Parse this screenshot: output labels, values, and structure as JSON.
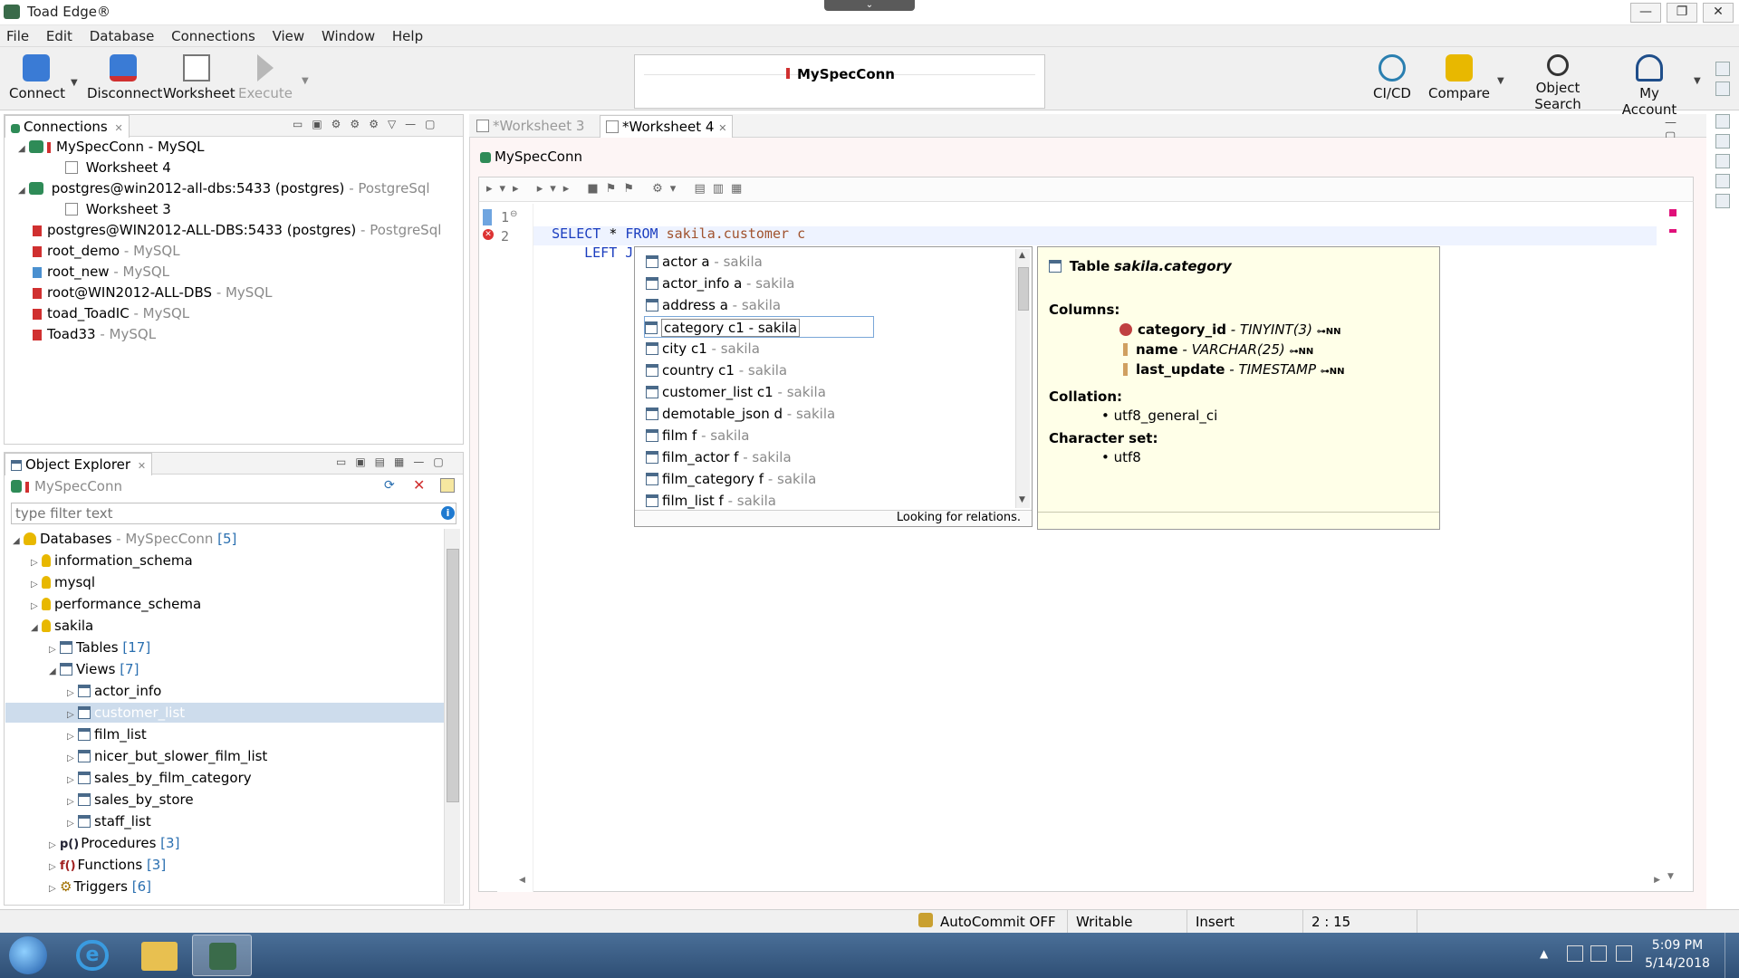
{
  "window": {
    "title": "Toad Edge®",
    "minimize": "—",
    "restore": "❐",
    "close": "✕"
  },
  "menu": [
    "File",
    "Edit",
    "Database",
    "Connections",
    "View",
    "Window",
    "Help"
  ],
  "toolbar": {
    "connect": "Connect",
    "disconnect": "Disconnect",
    "worksheet": "Worksheet",
    "execute": "Execute",
    "active_connection": "MySpecConn",
    "cicd": "CI/CD",
    "compare": "Compare",
    "object_search": "Object Search",
    "my_account": "My Account"
  },
  "connections_panel": {
    "title": "Connections",
    "items": [
      {
        "name": "MySpecConn",
        "type": "- MySQL"
      },
      {
        "name": "Worksheet 4",
        "type": ""
      },
      {
        "name": "postgres@win2012-all-dbs:5433 (postgres)",
        "type": "- PostgreSql"
      },
      {
        "name": "Worksheet 3",
        "type": ""
      },
      {
        "name": "postgres@WIN2012-ALL-DBS:5433 (postgres)",
        "type": "- PostgreSql"
      },
      {
        "name": "root_demo",
        "type": "- MySQL"
      },
      {
        "name": "root_new",
        "type": "- MySQL"
      },
      {
        "name": "root@WIN2012-ALL-DBS",
        "type": "- MySQL"
      },
      {
        "name": "toad_ToadIC",
        "type": "- MySQL"
      },
      {
        "name": "Toad33",
        "type": "- MySQL"
      }
    ]
  },
  "object_explorer": {
    "title": "Object Explorer",
    "connection": "MySpecConn",
    "filter_placeholder": "type filter text",
    "tree": {
      "databases": {
        "label": "Databases",
        "conn": "- MySpecConn",
        "count": "[5]"
      },
      "information_schema": "information_schema",
      "mysql": "mysql",
      "performance_schema": "performance_schema",
      "sakila": "sakila",
      "tables": {
        "label": "Tables",
        "count": "[17]"
      },
      "views": {
        "label": "Views",
        "count": "[7]"
      },
      "view_items": [
        "actor_info",
        "customer_list",
        "film_list",
        "nicer_but_slower_film_list",
        "sales_by_film_category",
        "sales_by_store",
        "staff_list"
      ],
      "procedures": {
        "label": "Procedures",
        "count": "[3]"
      },
      "functions": {
        "label": "Functions",
        "count": "[3]"
      },
      "triggers": {
        "label": "Triggers",
        "count": "[6]"
      }
    }
  },
  "editor": {
    "tabs": [
      {
        "label": "*Worksheet 3",
        "active": false
      },
      {
        "label": "*Worksheet 4",
        "active": true
      }
    ],
    "connection": "MySpecConn",
    "line1_no": "1",
    "line2_no": "2",
    "line1": {
      "kw1": "SELECT",
      "star": "*",
      "kw2": "FROM",
      "ident": "sakila.customer",
      "alias": "c"
    },
    "line2": {
      "kw": "LEFT JOIN"
    }
  },
  "autocomplete": {
    "items": [
      {
        "name": "actor a",
        "schema": "- sakila"
      },
      {
        "name": "actor_info a",
        "schema": "- sakila"
      },
      {
        "name": "address a",
        "schema": "- sakila"
      },
      {
        "name": "category c1",
        "schema": "- sakila"
      },
      {
        "name": "city c1",
        "schema": "- sakila"
      },
      {
        "name": "country c1",
        "schema": "- sakila"
      },
      {
        "name": "customer_list c1",
        "schema": "- sakila"
      },
      {
        "name": "demotable_json d",
        "schema": "- sakila"
      },
      {
        "name": "film f",
        "schema": "- sakila"
      },
      {
        "name": "film_actor f",
        "schema": "- sakila"
      },
      {
        "name": "film_category f",
        "schema": "- sakila"
      },
      {
        "name": "film_list f",
        "schema": "- sakila"
      }
    ],
    "status": "Looking for relations."
  },
  "info_popup": {
    "title_prefix": "Table",
    "title_name": "sakila.category",
    "columns_label": "Columns:",
    "columns": [
      {
        "name": "category_id",
        "type": "- TINYINT(3)"
      },
      {
        "name": "name",
        "type": "- VARCHAR(25)"
      },
      {
        "name": "last_update",
        "type": "- TIMESTAMP"
      }
    ],
    "collation_label": "Collation:",
    "collation": "utf8_general_ci",
    "charset_label": "Character set:",
    "charset": "utf8"
  },
  "status_bar": {
    "autocommit": "AutoCommit OFF",
    "writable": "Writable",
    "insert": "Insert",
    "position": "2 : 15"
  },
  "taskbar": {
    "time": "5:09 PM",
    "date": "5/14/2018"
  }
}
